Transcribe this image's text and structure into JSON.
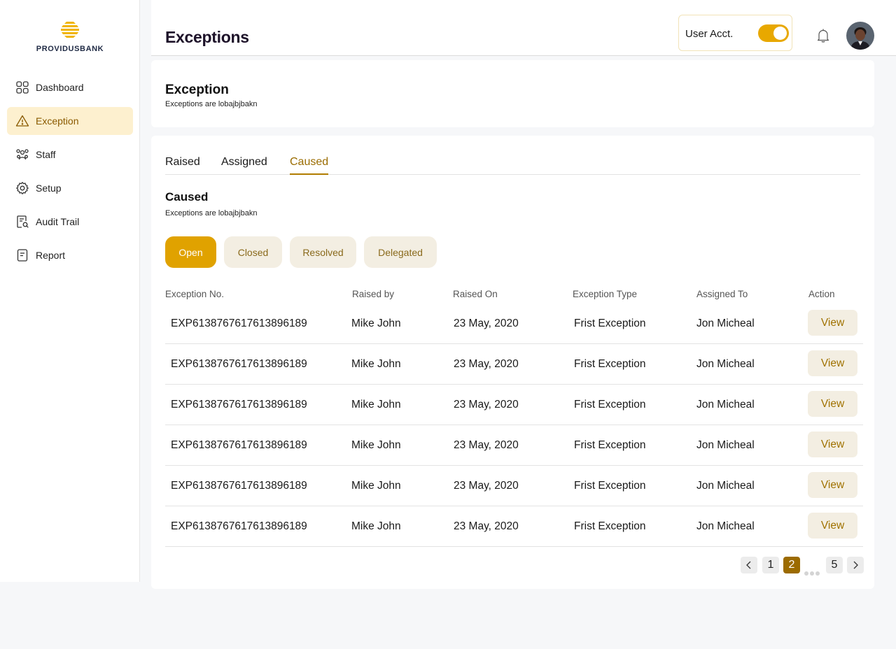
{
  "brand": {
    "name": "PROVIDUSBANK",
    "accent": "#e0a200"
  },
  "sidebar": {
    "items": [
      {
        "label": "Dashboard",
        "icon": "grid-icon"
      },
      {
        "label": "Exception",
        "icon": "warning-icon",
        "active": true
      },
      {
        "label": "Staff",
        "icon": "users-icon"
      },
      {
        "label": "Setup",
        "icon": "gear-icon"
      },
      {
        "label": "Audit Trail",
        "icon": "document-search-icon"
      },
      {
        "label": "Report",
        "icon": "report-icon"
      }
    ]
  },
  "header": {
    "title": "Exceptions",
    "account_label": "User Acct.",
    "account_toggle_on": true
  },
  "summary_card": {
    "title": "Exception",
    "subtitle": "Exceptions are lobajbjbakn"
  },
  "tabs": [
    {
      "label": "Raised"
    },
    {
      "label": "Assigned"
    },
    {
      "label": "Caused",
      "active": true
    }
  ],
  "section": {
    "title": "Caused",
    "subtitle": "Exceptions are lobajbjbakn"
  },
  "filters": [
    {
      "label": "Open",
      "active": true
    },
    {
      "label": "Closed"
    },
    {
      "label": "Resolved"
    },
    {
      "label": "Delegated"
    }
  ],
  "table": {
    "columns": [
      "Exception No.",
      "Raised by",
      "Raised On",
      "Exception Type",
      "Assigned To",
      "Action"
    ],
    "rows": [
      {
        "no": "EXP6138767617613896189",
        "raised_by": "Mike John",
        "raised_on": "23 May, 2020",
        "type": "Frist Exception",
        "assigned_to": "Jon Micheal",
        "action": "View"
      },
      {
        "no": "EXP6138767617613896189",
        "raised_by": "Mike John",
        "raised_on": "23 May, 2020",
        "type": "Frist Exception",
        "assigned_to": "Jon Micheal",
        "action": "View"
      },
      {
        "no": "EXP6138767617613896189",
        "raised_by": "Mike John",
        "raised_on": "23 May, 2020",
        "type": "Frist Exception",
        "assigned_to": "Jon Micheal",
        "action": "View"
      },
      {
        "no": "EXP6138767617613896189",
        "raised_by": "Mike John",
        "raised_on": "23 May, 2020",
        "type": "Frist Exception",
        "assigned_to": "Jon Micheal",
        "action": "View"
      },
      {
        "no": "EXP6138767617613896189",
        "raised_by": "Mike John",
        "raised_on": "23 May, 2020",
        "type": "Frist Exception",
        "assigned_to": "Jon Micheal",
        "action": "View"
      },
      {
        "no": "EXP6138767617613896189",
        "raised_by": "Mike John",
        "raised_on": "23 May, 2020",
        "type": "Frist Exception",
        "assigned_to": "Jon Micheal",
        "action": "View"
      }
    ]
  },
  "pagination": {
    "pages": [
      "1",
      "2",
      "5"
    ],
    "current": "2"
  }
}
